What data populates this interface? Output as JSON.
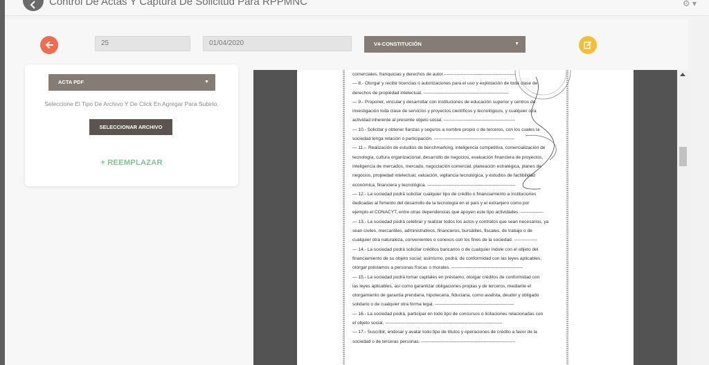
{
  "header": {
    "title": "Control De Actas Y Captura De Solicitud Para RPPMNC"
  },
  "toolbar": {
    "number_value": "25",
    "date_value": "01/04/2020",
    "act_type_selected": "V4-CONSTITUCIÓN"
  },
  "upload": {
    "file_type_selected": "ACTA PDF",
    "hint": "Seleccione El Tipo De Archivo Y De Click En Agregar Para Subirlo.",
    "select_file_label": "SELECCIONAR ARCHIVO",
    "replace_label": "+ REEMPLAZAR"
  },
  "document": {
    "lines": [
      "comerciales, franquicias y derechos de autor.-----------------------------------------------",
      "— 8.- Otorgar y recibir licencias o autorizaciones para el uso y explotación de toda clase de",
      "derechos de propiedad intelectual. --------------------------------------------------------",
      "— 9.- Proponer, vincular y desarrollar con instituciones de educación superior y centros de",
      "investigación toda clase de servicios y proyectos científicos y tecnológicos, y cualquier otra",
      "actividad inherente al presente objeto social. -----------------------------------------------",
      "— 10.- Solicitar y obtener fianzas y seguros a nombre propio o de terceros, con los cuales la",
      "sociedad tenga relación o participación. -----------------------------------------------------",
      "— 11.-. Realización de estudios de benchmarking, inteligencia competitiva, comercialización de",
      "tecnología, cultura organizacional, desarrollo de negocios, evaluación financiera de proyectos,",
      "inteligencia de mercados, mercado, negociación comercial, planeación estratégica, planes de",
      "negocios, propiedad intelectual, valuación, vigilancia tecnológica, y estudios de factibilidad",
      "económica, financiera y tecnológica. ----------------------------------------------------------",
      "— 12.- La sociedad podrá solicitar cualquier tipo de crédito o financiamiento a instituciones",
      "dedicadas al fomento del desarrollo de la tecnología en el país y el extranjero como por",
      "ejemplo el CONACYT, entre otras dependencias que apoyen este tipo actividades. ---------------",
      "— 13.- La sociedad podrá celebrar y realizar todos los actos y contratos que sean necesarios, ya",
      "sean civiles, mercantiles, administrativos, financieros, bursátiles, fiscales, de trabajo o de",
      "cualquier otra naturaleza, convenientes o conexos con los fines de la sociedad. ---------------",
      "— 14.- La sociedad podrá solicitar créditos bancarios o de cualquier índole con el objeto del",
      "financiamiento de su objeto social; asimismo, podrá, de conformidad con las leyes aplicables,",
      "otorgar préstamos a personas físicas o morales. -----------------------------------------------",
      "— 15.- La sociedad podrá tomar capitales en préstamo, otorgar créditos de conformidad con",
      "las leyes aplicables, así como garantizar obligaciones propias y de terceros, mediante el",
      "otorgamiento de garantía prendaria, hipotecaria, fiduciaria, como avalista, deudor y obligado",
      "solidario o de cualquier otra forma legal. ----------------------------------------------------",
      "— 16.- La sociedad podrá, participar en todo tipo de concursos o licitaciones relacionadas con",
      "el objeto social. -----------------------------------------------------------------------------",
      "— 17.- Suscribir, endosar y avalar todo tipo de títulos y operaciones de crédito a favor de la",
      "sociedad o de terceras personas. --------------------------------------------------------------"
    ]
  },
  "colors": {
    "back_button": "#f06c4f",
    "edit_button": "#f3bf3a",
    "replace_text": "#7dc58f",
    "dark_button": "#5c5451",
    "select_bg": "#867c76"
  },
  "icons": {
    "back": "arrow-left-icon",
    "edit": "edit-icon",
    "settings": "gear-icon",
    "caret": "caret-down-icon"
  }
}
